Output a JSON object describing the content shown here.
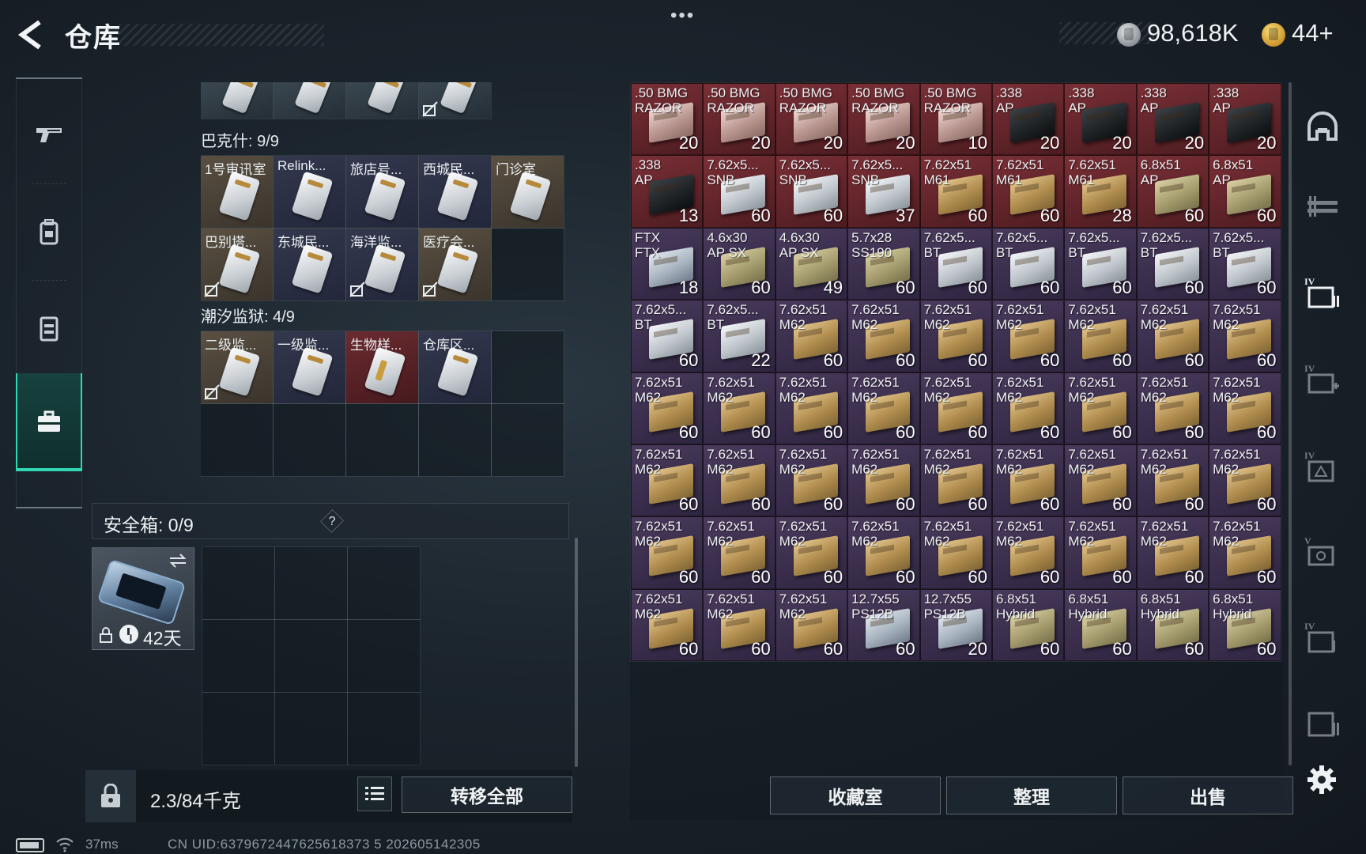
{
  "header": {
    "title": "仓库",
    "menu_dots": "•••",
    "currency": {
      "money": "98,618K",
      "gold": "44+"
    }
  },
  "left_nav": [
    "weapon-icon",
    "backpack-icon",
    "vest-icon",
    "case-icon"
  ],
  "stash": {
    "partial_row_count": 4,
    "sections": [
      {
        "label": "巴克什: 9/9",
        "grid_rows": 2,
        "items": [
          {
            "name": "1号审讯室",
            "color": "tan"
          },
          {
            "name": "Relink...",
            "color": "navy"
          },
          {
            "name": "旅店号...",
            "color": "navy"
          },
          {
            "name": "西城民...",
            "color": "navy"
          },
          {
            "name": "门诊室",
            "color": "tan"
          },
          {
            "name": "巴别塔...",
            "color": "tan",
            "unlinked": true
          },
          {
            "name": "东城民...",
            "color": "navy"
          },
          {
            "name": "海洋监...",
            "color": "navy",
            "unlinked": true
          },
          {
            "name": "医疗会...",
            "color": "tan",
            "unlinked": true
          }
        ]
      },
      {
        "label": "潮汐监狱: 4/9",
        "grid_rows": 2,
        "items": [
          {
            "name": "二级监...",
            "color": "tan",
            "unlinked": true
          },
          {
            "name": "一级监...",
            "color": "navy"
          },
          {
            "name": "生物样...",
            "color": "red"
          },
          {
            "name": "仓库区...",
            "color": "navy"
          }
        ]
      }
    ]
  },
  "safe_box": {
    "label": "安全箱: 0/9",
    "help": "?",
    "days": "42天",
    "slots": 9
  },
  "bottom_left": {
    "weight": "2.3/84千克",
    "transfer_label": "转移全部"
  },
  "ammo": [
    {
      "name": ".50 BMG\nRAZOR",
      "count": "20",
      "rarity": "red",
      "box": "pink"
    },
    {
      "name": ".50 BMG\nRAZOR",
      "count": "20",
      "rarity": "red",
      "box": "pink"
    },
    {
      "name": ".50 BMG\nRAZOR",
      "count": "20",
      "rarity": "red",
      "box": "pink"
    },
    {
      "name": ".50 BMG\nRAZOR",
      "count": "20",
      "rarity": "red",
      "box": "pink"
    },
    {
      "name": ".50 BMG\nRAZOR",
      "count": "10",
      "rarity": "red",
      "box": "pink"
    },
    {
      "name": ".338\nAP",
      "count": "20",
      "rarity": "red",
      "box": "black"
    },
    {
      "name": ".338\nAP",
      "count": "20",
      "rarity": "red",
      "box": "black"
    },
    {
      "name": ".338\nAP",
      "count": "20",
      "rarity": "red",
      "box": "black"
    },
    {
      "name": ".338\nAP",
      "count": "20",
      "rarity": "red",
      "box": "black"
    },
    {
      "name": ".338\nAP",
      "count": "13",
      "rarity": "red",
      "box": "black"
    },
    {
      "name": "7.62x5...\nSNB",
      "count": "60",
      "rarity": "red",
      "box": "white"
    },
    {
      "name": "7.62x5...\nSNB",
      "count": "60",
      "rarity": "red",
      "box": "white"
    },
    {
      "name": "7.62x5...\nSNB",
      "count": "37",
      "rarity": "red",
      "box": "white"
    },
    {
      "name": "7.62x51\nM61",
      "count": "60",
      "rarity": "red",
      "box": "tan"
    },
    {
      "name": "7.62x51\nM61",
      "count": "60",
      "rarity": "red",
      "box": "tan"
    },
    {
      "name": "7.62x51\nM61",
      "count": "28",
      "rarity": "red",
      "box": "tan"
    },
    {
      "name": "6.8x51\nAP",
      "count": "60",
      "rarity": "red",
      "box": "khaki"
    },
    {
      "name": "6.8x51\nAP",
      "count": "60",
      "rarity": "red",
      "box": "khaki"
    },
    {
      "name": "FTX\nFTX",
      "count": "18",
      "rarity": "purple",
      "box": "silver"
    },
    {
      "name": "4.6x30\nAP SX",
      "count": "60",
      "rarity": "purple",
      "box": "khaki"
    },
    {
      "name": "4.6x30\nAP SX",
      "count": "49",
      "rarity": "purple",
      "box": "khaki"
    },
    {
      "name": "5.7x28\nSS190",
      "count": "60",
      "rarity": "purple",
      "box": "khaki"
    },
    {
      "name": "7.62x5...\nBT",
      "count": "60",
      "rarity": "purple",
      "box": "white"
    },
    {
      "name": "7.62x5...\nBT",
      "count": "60",
      "rarity": "purple",
      "box": "white"
    },
    {
      "name": "7.62x5...\nBT",
      "count": "60",
      "rarity": "purple",
      "box": "white"
    },
    {
      "name": "7.62x5...\nBT",
      "count": "60",
      "rarity": "purple",
      "box": "white"
    },
    {
      "name": "7.62x5...\nBT",
      "count": "60",
      "rarity": "purple",
      "box": "white"
    },
    {
      "name": "7.62x5...\nBT",
      "count": "60",
      "rarity": "purple",
      "box": "white"
    },
    {
      "name": "7.62x5...\nBT",
      "count": "22",
      "rarity": "purple",
      "box": "white"
    },
    {
      "name": "7.62x51\nM62",
      "count": "60",
      "rarity": "purple",
      "box": "tan"
    },
    {
      "name": "7.62x51\nM62",
      "count": "60",
      "rarity": "purple",
      "box": "tan"
    },
    {
      "name": "7.62x51\nM62",
      "count": "60",
      "rarity": "purple",
      "box": "tan"
    },
    {
      "name": "7.62x51\nM62",
      "count": "60",
      "rarity": "purple",
      "box": "tan"
    },
    {
      "name": "7.62x51\nM62",
      "count": "60",
      "rarity": "purple",
      "box": "tan"
    },
    {
      "name": "7.62x51\nM62",
      "count": "60",
      "rarity": "purple",
      "box": "tan"
    },
    {
      "name": "7.62x51\nM62",
      "count": "60",
      "rarity": "purple",
      "box": "tan"
    },
    {
      "name": "7.62x51\nM62",
      "count": "60",
      "rarity": "purple",
      "box": "tan"
    },
    {
      "name": "7.62x51\nM62",
      "count": "60",
      "rarity": "purple",
      "box": "tan"
    },
    {
      "name": "7.62x51\nM62",
      "count": "60",
      "rarity": "purple",
      "box": "tan"
    },
    {
      "name": "7.62x51\nM62",
      "count": "60",
      "rarity": "purple",
      "box": "tan"
    },
    {
      "name": "7.62x51\nM62",
      "count": "60",
      "rarity": "purple",
      "box": "tan"
    },
    {
      "name": "7.62x51\nM62",
      "count": "60",
      "rarity": "purple",
      "box": "tan"
    },
    {
      "name": "7.62x51\nM62",
      "count": "60",
      "rarity": "purple",
      "box": "tan"
    },
    {
      "name": "7.62x51\nM62",
      "count": "60",
      "rarity": "purple",
      "box": "tan"
    },
    {
      "name": "7.62x51\nM62",
      "count": "60",
      "rarity": "purple",
      "box": "tan"
    },
    {
      "name": "7.62x51\nM62",
      "count": "60",
      "rarity": "purple",
      "box": "tan"
    },
    {
      "name": "7.62x51\nM62",
      "count": "60",
      "rarity": "purple",
      "box": "tan"
    },
    {
      "name": "7.62x51\nM62",
      "count": "60",
      "rarity": "purple",
      "box": "tan"
    },
    {
      "name": "7.62x51\nM62",
      "count": "60",
      "rarity": "purple",
      "box": "tan"
    },
    {
      "name": "7.62x51\nM62",
      "count": "60",
      "rarity": "purple",
      "box": "tan"
    },
    {
      "name": "7.62x51\nM62",
      "count": "60",
      "rarity": "purple",
      "box": "tan"
    },
    {
      "name": "7.62x51\nM62",
      "count": "60",
      "rarity": "purple",
      "box": "tan"
    },
    {
      "name": "7.62x51\nM62",
      "count": "60",
      "rarity": "purple",
      "box": "tan"
    },
    {
      "name": "7.62x51\nM62",
      "count": "60",
      "rarity": "purple",
      "box": "tan"
    },
    {
      "name": "7.62x51\nM62",
      "count": "60",
      "rarity": "purple",
      "box": "tan"
    },
    {
      "name": "7.62x51\nM62",
      "count": "60",
      "rarity": "purple",
      "box": "tan"
    },
    {
      "name": "7.62x51\nM62",
      "count": "60",
      "rarity": "purple",
      "box": "tan"
    },
    {
      "name": "7.62x51\nM62",
      "count": "60",
      "rarity": "purple",
      "box": "tan"
    },
    {
      "name": "7.62x51\nM62",
      "count": "60",
      "rarity": "purple",
      "box": "tan"
    },
    {
      "name": "7.62x51\nM62",
      "count": "60",
      "rarity": "purple",
      "box": "tan"
    },
    {
      "name": "7.62x51\nM62",
      "count": "60",
      "rarity": "purple",
      "box": "tan"
    },
    {
      "name": "7.62x51\nM62",
      "count": "60",
      "rarity": "purple",
      "box": "tan"
    },
    {
      "name": "7.62x51\nM62",
      "count": "60",
      "rarity": "purple",
      "box": "tan"
    },
    {
      "name": "7.62x51\nM62",
      "count": "60",
      "rarity": "purple",
      "box": "tan"
    },
    {
      "name": "7.62x51\nM62",
      "count": "60",
      "rarity": "purple",
      "box": "tan"
    },
    {
      "name": "7.62x51\nM62",
      "count": "60",
      "rarity": "purple",
      "box": "tan"
    },
    {
      "name": "12.7x55\nPS12B",
      "count": "60",
      "rarity": "purple",
      "box": "silver"
    },
    {
      "name": "12.7x55\nPS12B",
      "count": "20",
      "rarity": "purple",
      "box": "silver"
    },
    {
      "name": "6.8x51\nHybrid",
      "count": "60",
      "rarity": "purple",
      "box": "khaki"
    },
    {
      "name": "6.8x51\nHybrid",
      "count": "60",
      "rarity": "purple",
      "box": "khaki"
    },
    {
      "name": "6.8x51\nHybrid",
      "count": "60",
      "rarity": "purple",
      "box": "khaki"
    },
    {
      "name": "6.8x51\nHybrid",
      "count": "60",
      "rarity": "purple",
      "box": "khaki"
    }
  ],
  "right_rail": [
    "helmet-icon",
    "rifle-rack-icon",
    "ammo-box-icon",
    "medkit-box-icon",
    "grenade-box-icon",
    "camera-box-icon",
    "folder-box-icon",
    "archive-box-icon"
  ],
  "bottom_buttons": {
    "collection": "收藏室",
    "sort": "整理",
    "sell": "出售"
  },
  "status": {
    "ping": "37ms",
    "uid": "CN UID:6379672447625618373 5 202605142305"
  }
}
